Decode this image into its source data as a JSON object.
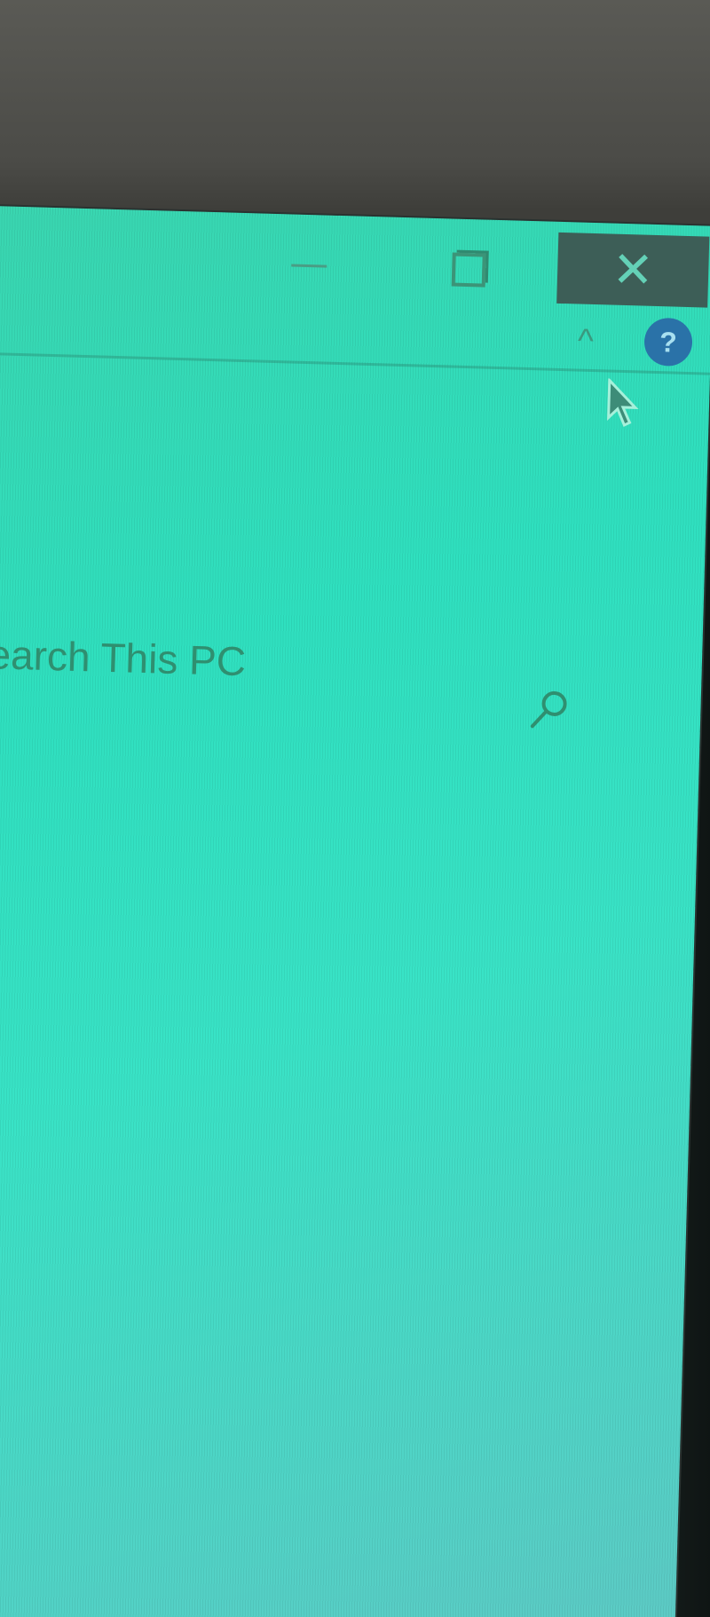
{
  "window": {
    "minimize_label": "—",
    "close_label": "✕"
  },
  "ribbon": {
    "help_label": "?"
  },
  "search": {
    "placeholder": "Search This PC",
    "value": ""
  },
  "icons": {
    "minimize": "minimize-icon",
    "maximize": "maximize-icon",
    "close": "close-icon",
    "chevron": "chevron-up-icon",
    "help": "help-icon",
    "search": "search-icon",
    "cursor": "mouse-cursor-icon"
  },
  "colors": {
    "screen_tint": "#39e3c6",
    "close_hover": "#3d5e57",
    "help_badge": "#2a72a8",
    "text": "#2f8f70"
  }
}
